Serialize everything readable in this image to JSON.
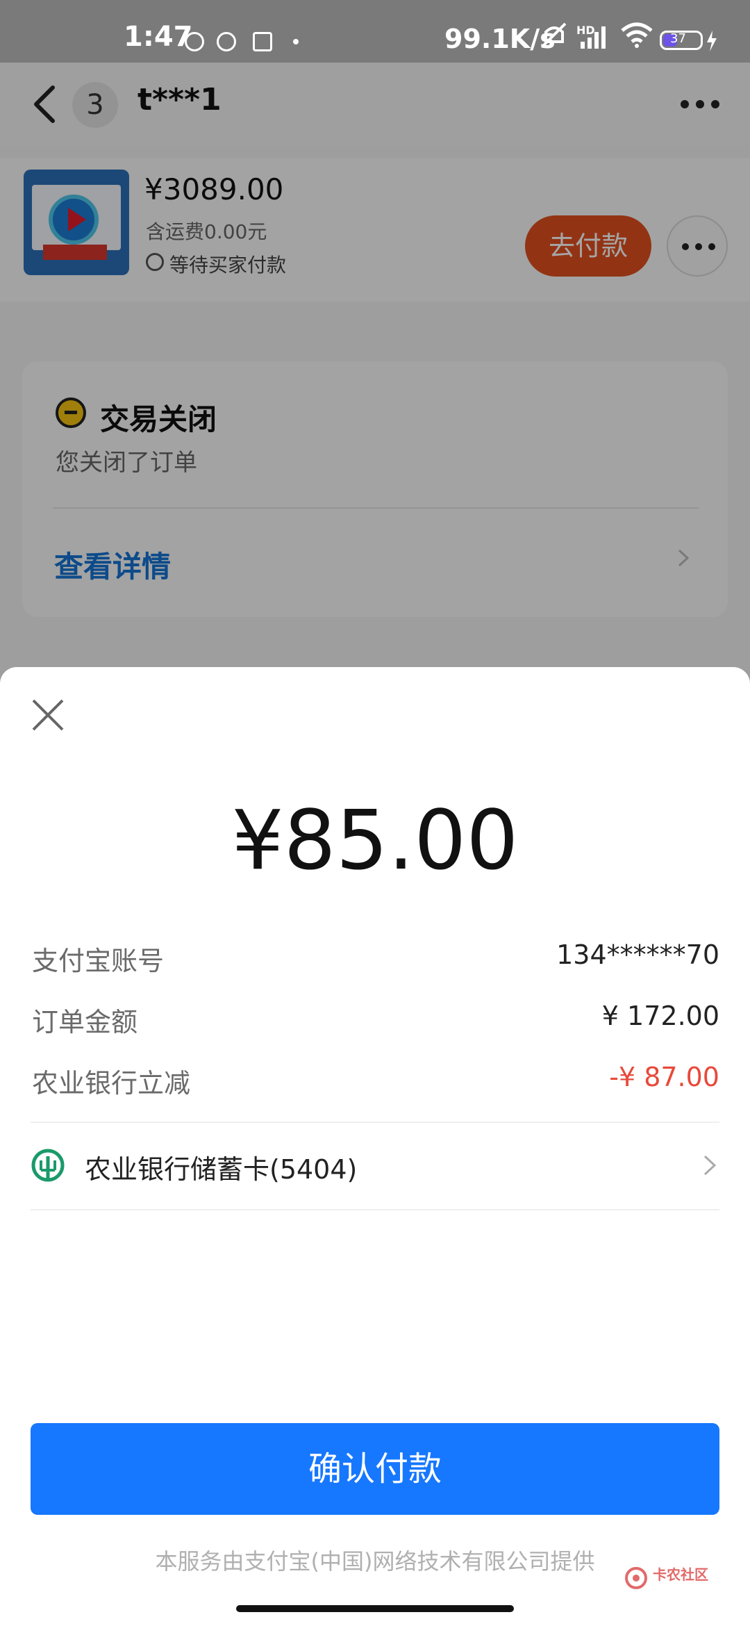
{
  "status_bar": {
    "time": "1:47",
    "network_speed": "99.1K/s",
    "signal_label": "HD",
    "battery": "37"
  },
  "header": {
    "back_icon": "chevron-left-icon",
    "badge_count": "3",
    "title": "t***1",
    "more_icon": "more-horizontal-icon"
  },
  "order": {
    "price": "¥3089.00",
    "shipping": "含运费0.00元",
    "status": "等待买家付款",
    "pay_button": "去付款"
  },
  "transaction": {
    "title": "交易关闭",
    "subtitle": "您关闭了订单",
    "details_link": "查看详情"
  },
  "payment_sheet": {
    "amount": "¥85.00",
    "rows": [
      {
        "label": "支付宝账号",
        "value": "134******70"
      },
      {
        "label": "订单金额",
        "value": "¥ 172.00"
      },
      {
        "label": "农业银行立减",
        "value": "-¥ 87.00"
      }
    ],
    "payment_method": "农业银行储蓄卡(5404)",
    "confirm_button": "确认付款",
    "footer": "本服务由支付宝(中国)网络技术有限公司提供"
  },
  "watermark": "卡农社区",
  "colors": {
    "accent": "#1677ff",
    "pay_button": "#e0501f",
    "discount": "#e8493a",
    "link": "#1473d4"
  }
}
